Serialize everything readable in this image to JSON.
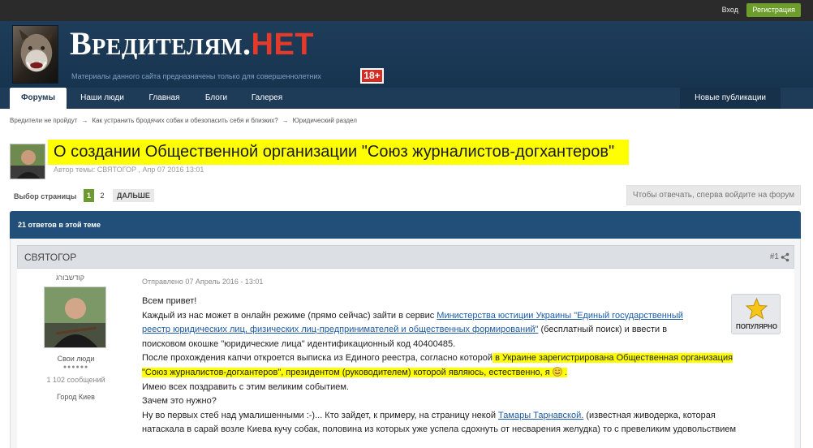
{
  "topbar": {
    "login": "Вход",
    "register": "Регистрация"
  },
  "header": {
    "title_main": "Вредителям.",
    "title_accent": "НЕТ",
    "subtitle": "Материалы данного сайта предназначены только для совершеннолетних",
    "age_badge": "18+"
  },
  "nav": {
    "items": [
      {
        "label": "Форумы",
        "active": true
      },
      {
        "label": "Наши люди",
        "active": false
      },
      {
        "label": "Главная",
        "active": false
      },
      {
        "label": "Блоги",
        "active": false
      },
      {
        "label": "Галерея",
        "active": false
      }
    ],
    "right_item": "Новые публикации"
  },
  "breadcrumb": [
    "Вредители не пройдут",
    "Как устранить бродячих собак и обезопасить себя и близких?",
    "Юридический раздел"
  ],
  "topic": {
    "title": "О создании Общественной организации \"Союз журналистов-догхантеров\"",
    "meta": "Автор темы: СВЯТОГОР , Апр 07 2016 13:01"
  },
  "pager": {
    "label": "Выбор страницы",
    "pages": [
      "1",
      "2"
    ],
    "next": "ДАЛЬШЕ"
  },
  "reply_prompt": "Чтобы отвечать, сперва войдите на форум",
  "replies_count": "21 ответов в этой теме",
  "post": {
    "author": "СВЯТОГОР",
    "number": "#1",
    "user_title": "קודשבורג",
    "user_group": "Свои люди",
    "user_pips": "●●●●●●",
    "user_posts": "1 102 сообщений",
    "user_city": "Город Киев",
    "posted_at": "Отправлено 07 Апрель 2016 - 13:01",
    "popular": "ПОПУЛЯРНО",
    "text": {
      "l1": "Всем привет!",
      "l2_a": "Каждый из нас может в онлайн режиме (прямо сейчас) зайти в сервис ",
      "l2_link": "Министерства юстиции Украины \"Единый государственный",
      "l3_link": "реестр юридических лиц, физических лиц-предпринимателей и общественных формирований\"",
      "l3_b": "  (бесплатный поиск) и ввести в",
      "l4": "поисковом окошке \"юридические лица\" идентификационный код 40400485.",
      "l5_a": "После прохождения капчи откроется выписка из Единого реестра, согласно которой",
      "l5_hl": " в Украине зарегистрирована Общественная организация",
      "l6_hl": "\"Союз журналистов-догхантеров\", президентом (руководителем) которой являюсь, естественно, я ",
      "l6_end": " .",
      "l7": "Имею всех поздравить с этим великим событием.",
      "l8": "Зачем это нужно?",
      "l9_a": "Ну во первых стеб над умалишенными :-)... Кто зайдет, к примеру, на страницу некой ",
      "l9_link": "Тамары Тарнавской.",
      "l9_b": "  (известная живодерка, которая",
      "l10": "натаскала в сарай возле Киева кучу собак, половина из которых уже успела сдохнуть от несварения желудка) то с превеликим удовольствием"
    }
  }
}
